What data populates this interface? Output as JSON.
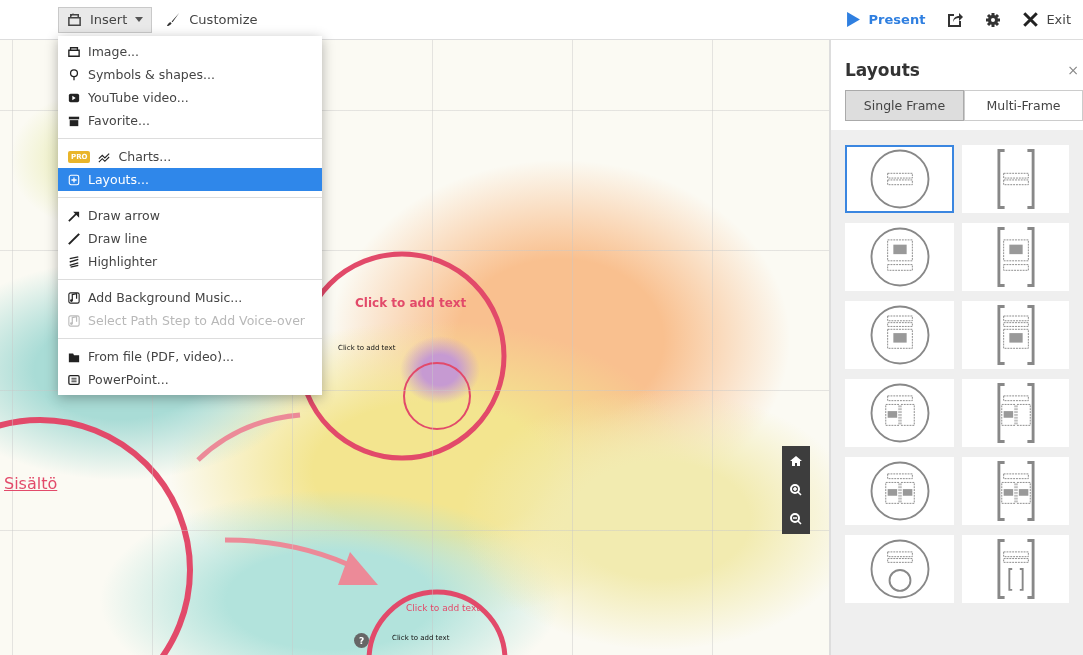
{
  "toolbar": {
    "insert": "Insert",
    "customize": "Customize",
    "present": "Present",
    "exit": "Exit"
  },
  "insert_menu": {
    "groups": [
      {
        "items": [
          {
            "label": "Image...",
            "selected": false,
            "disabled": false
          },
          {
            "label": "Symbols & shapes...",
            "selected": false,
            "disabled": false
          },
          {
            "label": "YouTube video...",
            "selected": false,
            "disabled": false
          },
          {
            "label": "Favorite...",
            "selected": false,
            "disabled": false
          }
        ]
      },
      {
        "items": [
          {
            "label": "Charts...",
            "badge": "PRO",
            "selected": false,
            "disabled": false
          },
          {
            "label": "Layouts...",
            "selected": true,
            "disabled": false
          }
        ]
      },
      {
        "items": [
          {
            "label": "Draw arrow",
            "selected": false,
            "disabled": false
          },
          {
            "label": "Draw line",
            "selected": false,
            "disabled": false
          },
          {
            "label": "Highlighter",
            "selected": false,
            "disabled": false
          }
        ]
      },
      {
        "items": [
          {
            "label": "Add Background Music...",
            "selected": false,
            "disabled": false
          },
          {
            "label": "Select Path Step to Add Voice-over",
            "selected": false,
            "disabled": true
          }
        ]
      },
      {
        "items": [
          {
            "label": "From file (PDF, video)...",
            "selected": false,
            "disabled": false
          },
          {
            "label": "PowerPoint...",
            "selected": false,
            "disabled": false
          }
        ]
      }
    ]
  },
  "canvas": {
    "texts": [
      {
        "kind": "title",
        "text": "Click to add text"
      },
      {
        "kind": "body",
        "text": "Click to add text"
      },
      {
        "kind": "heading",
        "text": "Sisältö"
      },
      {
        "kind": "title2",
        "text": "Click to add text"
      },
      {
        "kind": "body2",
        "text": "Click to add text"
      }
    ],
    "help": "?"
  },
  "layouts_panel": {
    "title": "Layouts",
    "close": "×",
    "tabs": [
      {
        "label": "Single Frame",
        "selected": true
      },
      {
        "label": "Multi-Frame",
        "selected": false
      }
    ],
    "tiles": [
      {
        "kind": "circle",
        "selected": true
      },
      {
        "kind": "bracket",
        "selected": false
      },
      {
        "kind": "circle",
        "selected": false
      },
      {
        "kind": "bracket",
        "selected": false
      },
      {
        "kind": "circle",
        "selected": false
      },
      {
        "kind": "bracket",
        "selected": false
      },
      {
        "kind": "circle",
        "selected": false
      },
      {
        "kind": "bracket",
        "selected": false
      },
      {
        "kind": "circle",
        "selected": false
      },
      {
        "kind": "bracket",
        "selected": false
      },
      {
        "kind": "circle",
        "selected": false
      },
      {
        "kind": "bracket",
        "selected": false
      }
    ]
  }
}
